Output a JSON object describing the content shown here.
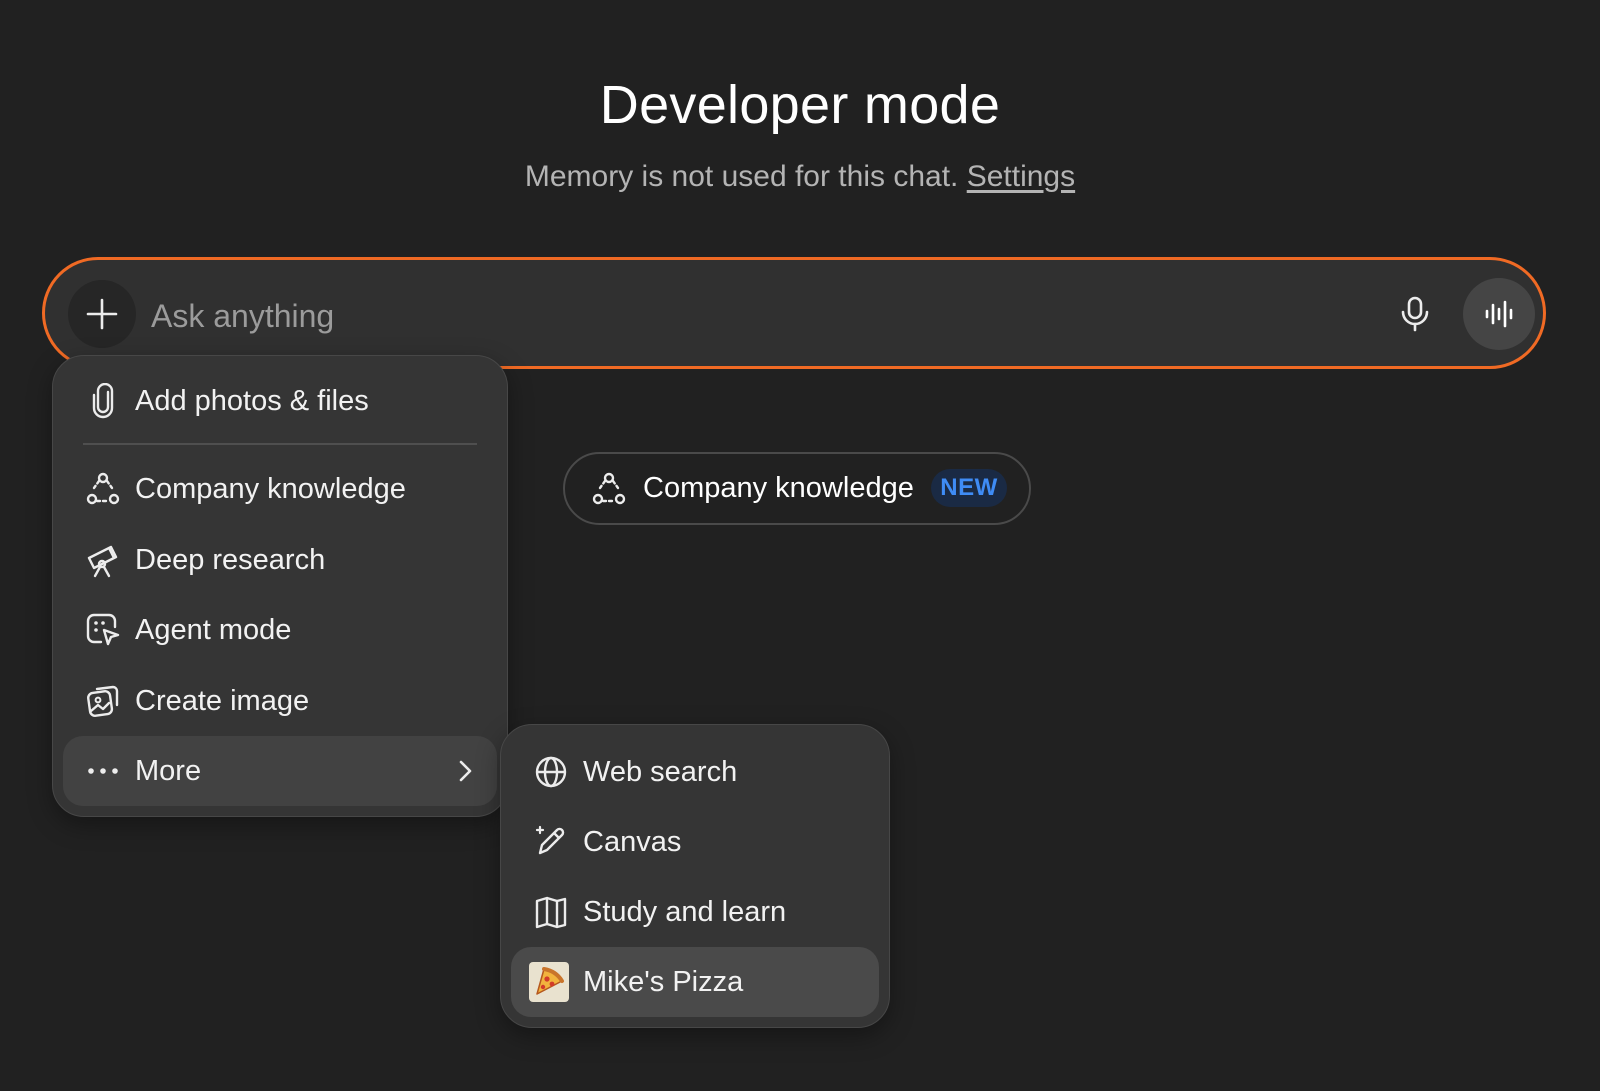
{
  "header": {
    "title": "Developer mode",
    "subtitle": "Memory is not used for this chat.",
    "settings_link": "Settings"
  },
  "composer": {
    "placeholder": "Ask anything",
    "accent_color": "#f06a24",
    "icons": {
      "add": "plus-icon",
      "mic": "microphone-icon",
      "voice": "voice-waveform-icon"
    }
  },
  "menu": {
    "items": [
      {
        "label": "Add photos & files",
        "icon": "paperclip-icon"
      },
      {
        "label": "Company knowledge",
        "icon": "company-knowledge-icon"
      },
      {
        "label": "Deep research",
        "icon": "telescope-icon"
      },
      {
        "label": "Agent mode",
        "icon": "agent-cursor-icon"
      },
      {
        "label": "Create image",
        "icon": "image-icon"
      },
      {
        "label": "More",
        "icon": "ellipsis-icon"
      }
    ]
  },
  "submenu": {
    "items": [
      {
        "label": "Web search",
        "icon": "globe-icon"
      },
      {
        "label": "Canvas",
        "icon": "pencil-sparkle-icon"
      },
      {
        "label": "Study and learn",
        "icon": "book-icon"
      },
      {
        "label": "Mike's Pizza",
        "icon": "pizza-icon"
      }
    ]
  },
  "chip": {
    "label": "Company knowledge",
    "badge": "NEW",
    "badge_color": "#3f8cf5"
  }
}
